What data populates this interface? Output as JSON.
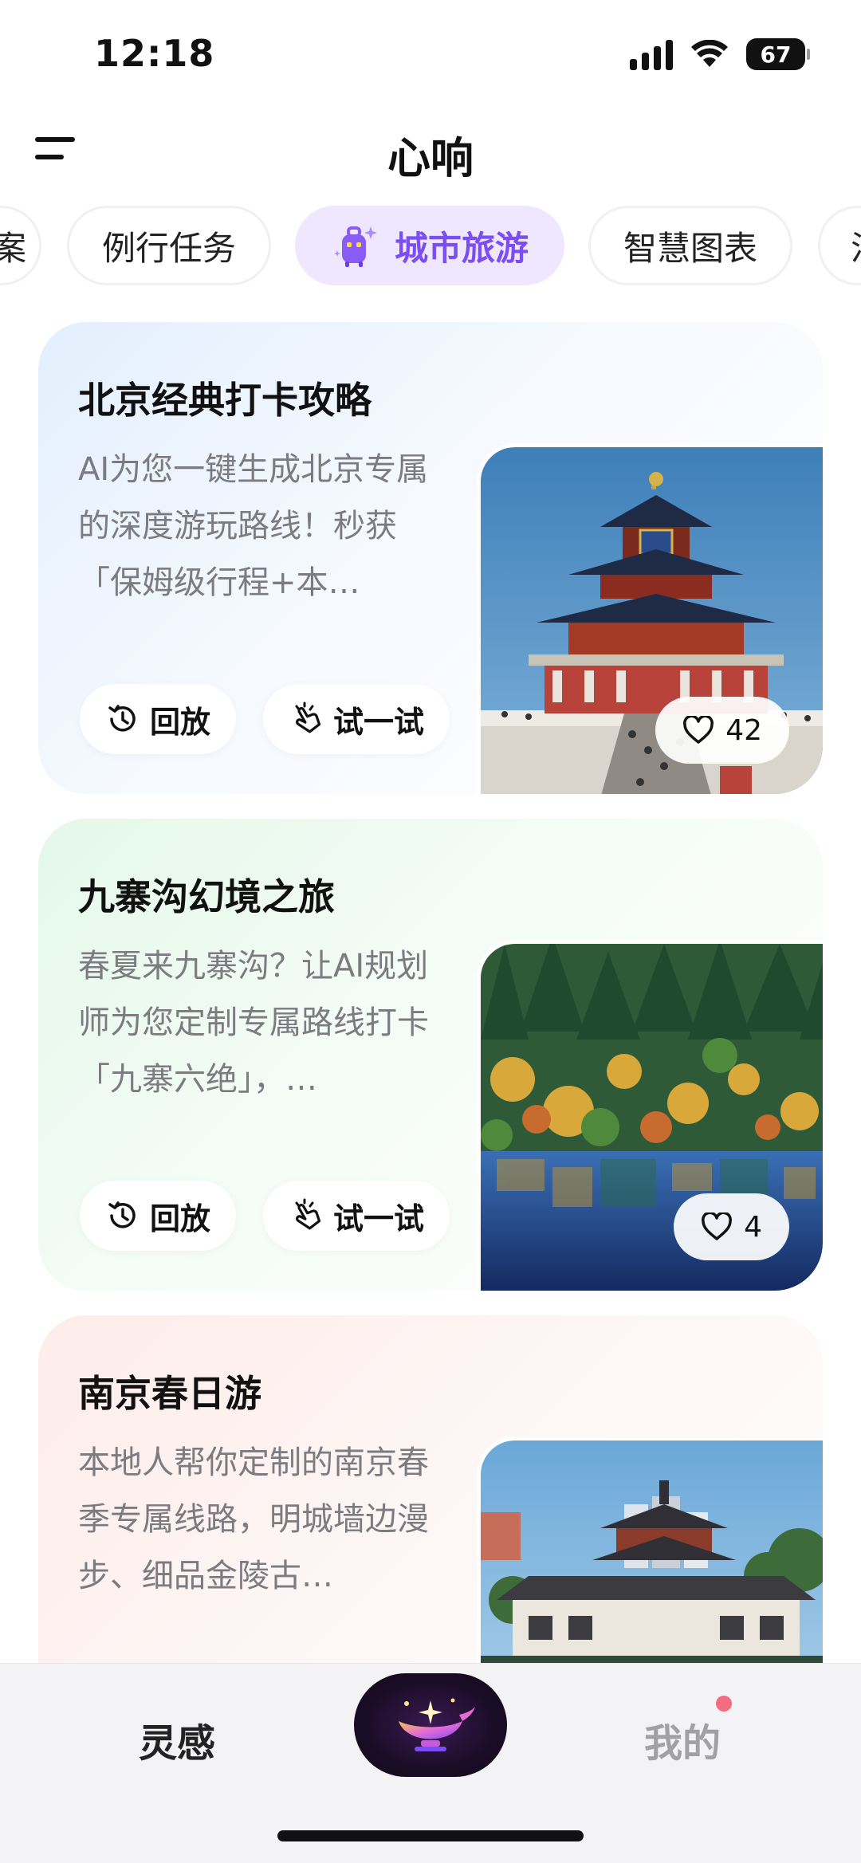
{
  "status_bar": {
    "time": "12:18",
    "battery": "67"
  },
  "header": {
    "title": "心响"
  },
  "tabs": [
    {
      "label": "案"
    },
    {
      "label": "例行任务"
    },
    {
      "label": "城市旅游",
      "active": true
    },
    {
      "label": "智慧图表"
    },
    {
      "label": "活"
    }
  ],
  "cards": [
    {
      "title": "北京经典打卡攻略",
      "description": "AI为您一键生成北京专属的深度游玩路线！秒获「保姆级行程+本…",
      "replay_label": "回放",
      "try_label": "试一试",
      "likes": "42",
      "image_icon": "temple-of-heaven-photo"
    },
    {
      "title": "九寨沟幻境之旅",
      "description": "春夏来九寨沟？让AI规划师为您定制专属路线打卡「九寨六绝」，…",
      "replay_label": "回放",
      "try_label": "试一试",
      "likes": "4",
      "image_icon": "jiuzhaigou-lake-photo"
    },
    {
      "title": "南京春日游",
      "description": "本地人帮你定制的南京春季专属线路，明城墙边漫步、细品金陵古…",
      "image_icon": "nanjing-pavilion-photo"
    }
  ],
  "bottom_nav": {
    "inspiration": "灵感",
    "mine": "我的",
    "center_icon": "magic-lamp-icon"
  },
  "colors": {
    "accent": "#7b4df2",
    "tab_active_bg": "#eee7ff",
    "badge_dot": "#f26d80"
  }
}
